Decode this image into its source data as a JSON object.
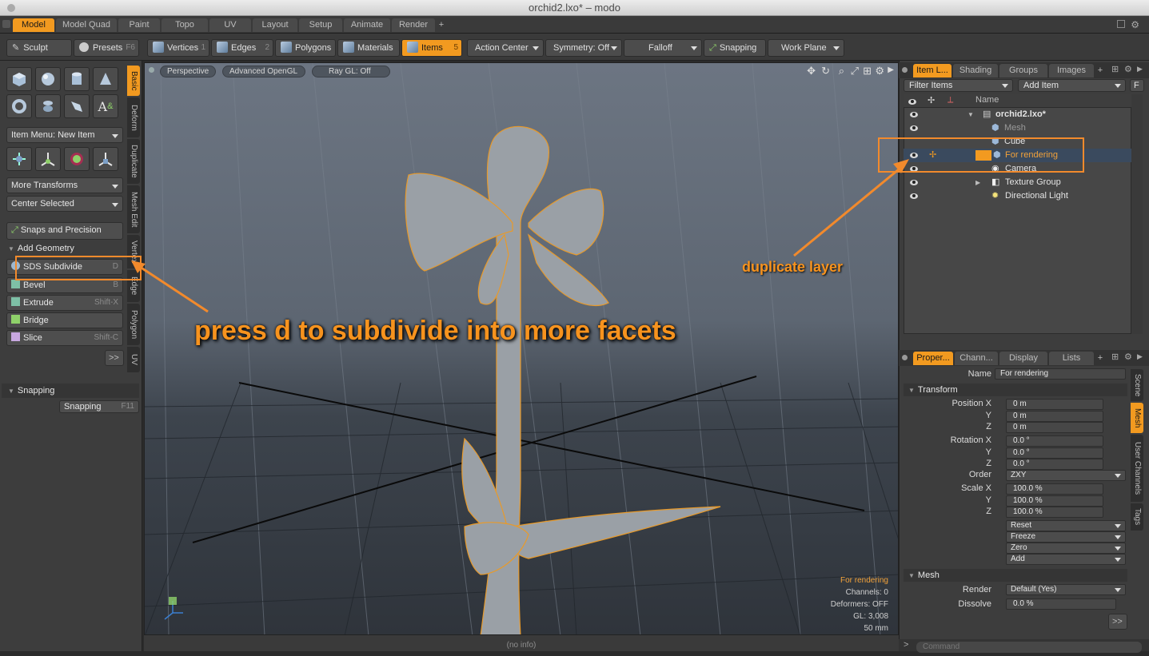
{
  "window": {
    "title": "orchid2.lxo* – modo"
  },
  "menu_tabs": [
    "Model",
    "Model Quad",
    "Paint",
    "Topo",
    "UV",
    "Layout",
    "Setup",
    "Animate",
    "Render",
    "+"
  ],
  "toolbar": {
    "sculpt": "Sculpt",
    "presets": "Presets",
    "presets_key": "F6",
    "vertices": "Vertices",
    "vertices_n": "1",
    "edges": "Edges",
    "edges_n": "2",
    "polygons": "Polygons",
    "materials": "Materials",
    "items": "Items",
    "items_n": "5",
    "action_center": "Action Center",
    "symmetry": "Symmetry: Off",
    "falloff": "Falloff",
    "snapping": "Snapping",
    "work_plane": "Work Plane"
  },
  "left": {
    "item_menu": "Item Menu: New Item",
    "more_transforms": "More Transforms",
    "center_selected": "Center Selected",
    "snaps_precision": "Snaps and Precision",
    "add_geometry": "Add Geometry",
    "tools": [
      {
        "label": "SDS Subdivide",
        "key": "D"
      },
      {
        "label": "Bevel",
        "key": "B"
      },
      {
        "label": "Extrude",
        "key": "Shift-X"
      },
      {
        "label": "Bridge",
        "key": ""
      },
      {
        "label": "Slice",
        "key": "Shift-C"
      }
    ],
    "more": ">>",
    "snapping_header": "Snapping",
    "snapping_btn": "Snapping",
    "snapping_key": "F11",
    "vtabs": [
      "Basic",
      "Deform",
      "Duplicate",
      "Mesh Edit",
      "Vertex",
      "Edge",
      "Polygon",
      "UV"
    ]
  },
  "viewport": {
    "view": "Perspective",
    "shading": "Advanced OpenGL",
    "raygl": "Ray GL: Off",
    "hud": {
      "item": "For rendering",
      "channels": "Channels: 0",
      "deformers": "Deformers: OFF",
      "gl": "GL: 3,008",
      "lens": "50 mm"
    },
    "status": "(no info)"
  },
  "annotations": {
    "subdivide": "press d to subdivide into more facets",
    "duplicate": "duplicate layer"
  },
  "items_panel": {
    "tabs": [
      "Item L...",
      "Shading",
      "Groups",
      "Images",
      "+"
    ],
    "filter": "Filter Items",
    "add_item": "Add Item",
    "f_btn": "F",
    "col_name": "Name",
    "rows": [
      {
        "label": "orchid2.lxo*",
        "indent": 0
      },
      {
        "label": "Mesh",
        "indent": 1
      },
      {
        "label": "Cube",
        "indent": 1
      },
      {
        "label": "For rendering",
        "indent": 1
      },
      {
        "label": "Camera",
        "indent": 1
      },
      {
        "label": "Texture Group",
        "indent": 1
      },
      {
        "label": "Directional Light",
        "indent": 1
      }
    ]
  },
  "props_panel": {
    "tabs": [
      "Proper...",
      "Chann...",
      "Display",
      "Lists",
      "+"
    ],
    "name_label": "Name",
    "name_value": "For rendering",
    "transform": "Transform",
    "position_label": "Position X",
    "rotation_label": "Rotation X",
    "scale_label": "Scale X",
    "y": "Y",
    "z": "Z",
    "pos": [
      "0 m",
      "0 m",
      "0 m"
    ],
    "rot": [
      "0.0 °",
      "0.0 °",
      "0.0 °"
    ],
    "order_label": "Order",
    "order_value": "ZXY",
    "scale": [
      "100.0 %",
      "100.0 %",
      "100.0 %"
    ],
    "reset": "Reset",
    "freeze": "Freeze",
    "zero": "Zero",
    "add": "Add",
    "mesh": "Mesh",
    "render_label": "Render",
    "render_value": "Default (Yes)",
    "dissolve_label": "Dissolve",
    "dissolve_value": "0.0 %",
    "more": ">>",
    "vtabs": [
      "Scene",
      "Mesh",
      "User Channels",
      "Tags"
    ],
    "command": "Command"
  },
  "colors": {
    "accent": "#f29a20",
    "annotation": "#f28a2c",
    "selection": "#3a4a5e"
  }
}
